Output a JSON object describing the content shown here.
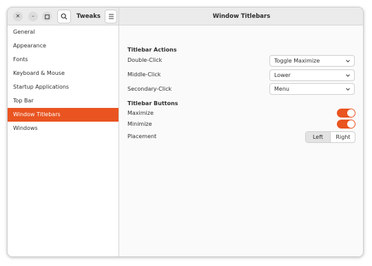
{
  "window": {
    "app_title": "Tweaks",
    "page_title": "Window Titlebars"
  },
  "header_icons": {
    "close": "close-icon",
    "minimize": "minimize-icon",
    "maximize": "maximize-icon",
    "search": "search-icon",
    "menu": "hamburger-menu-icon"
  },
  "sidebar": {
    "items": [
      {
        "label": "General"
      },
      {
        "label": "Appearance"
      },
      {
        "label": "Fonts"
      },
      {
        "label": "Keyboard & Mouse"
      },
      {
        "label": "Startup Applications"
      },
      {
        "label": "Top Bar"
      },
      {
        "label": "Window Titlebars"
      },
      {
        "label": "Windows"
      }
    ],
    "active_index": 6
  },
  "titlebar_actions": {
    "title": "Titlebar Actions",
    "double_click": {
      "label": "Double-Click",
      "value": "Toggle Maximize"
    },
    "middle_click": {
      "label": "Middle-Click",
      "value": "Lower"
    },
    "secondary_click": {
      "label": "Secondary-Click",
      "value": "Menu"
    }
  },
  "titlebar_buttons": {
    "title": "Titlebar Buttons",
    "maximize": {
      "label": "Maximize",
      "enabled": true
    },
    "minimize": {
      "label": "Minimize",
      "enabled": true
    },
    "placement": {
      "label": "Placement",
      "options": [
        "Left",
        "Right"
      ],
      "selected": "Left"
    }
  },
  "colors": {
    "accent": "#e95420",
    "header_bg": "#ebebeb",
    "sidebar_bg": "#ffffff",
    "content_bg": "#fafafa"
  }
}
